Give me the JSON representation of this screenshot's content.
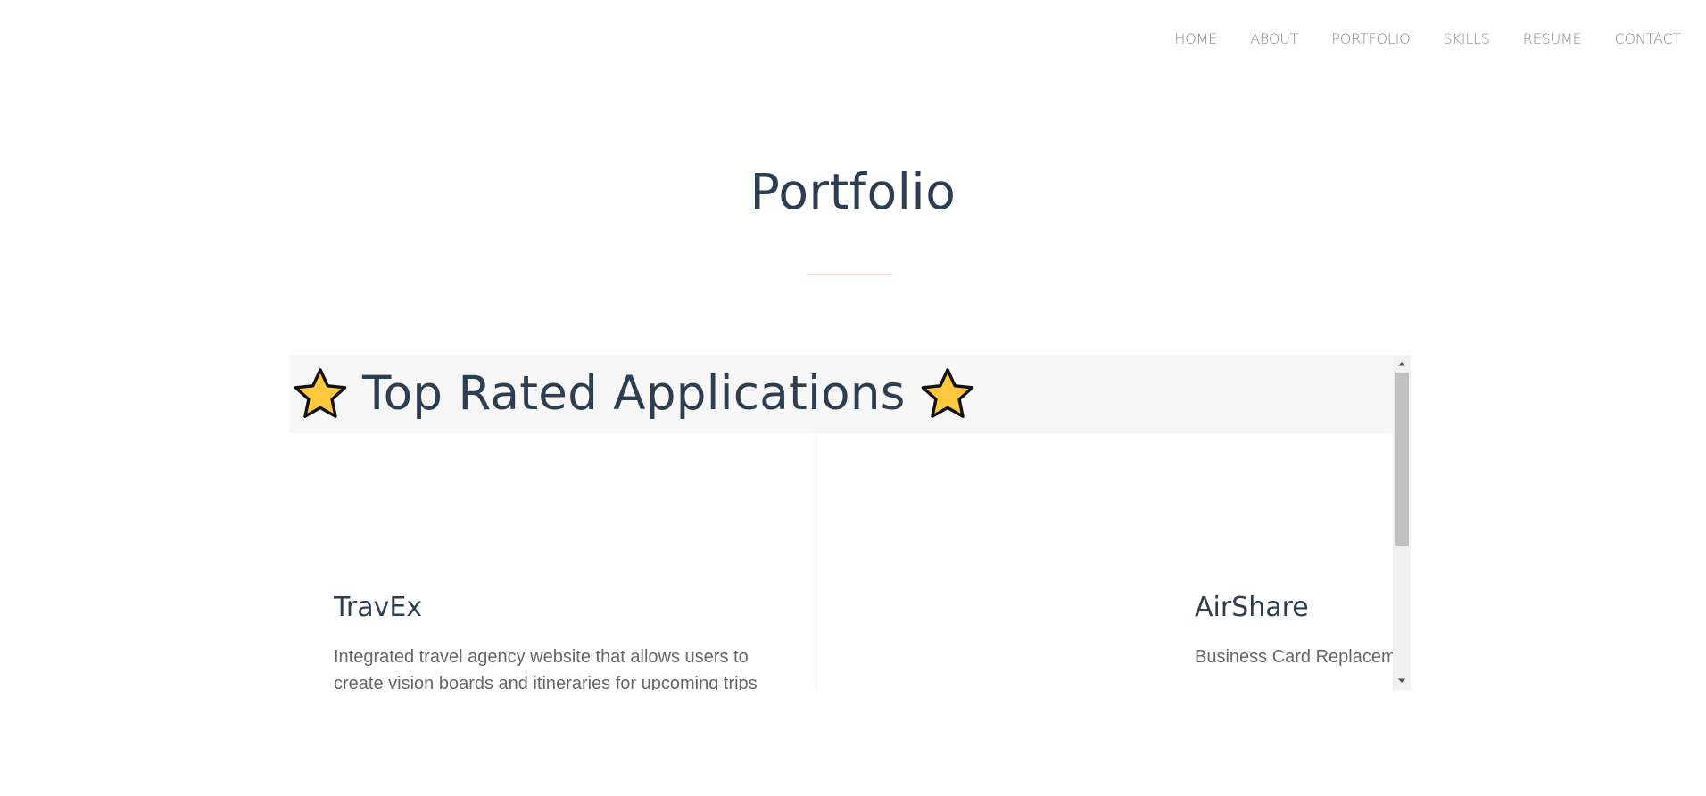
{
  "nav": {
    "items": [
      "HOME",
      "ABOUT",
      "PORTFOLIO",
      "SKILLS",
      "RESUME",
      "CONTACT"
    ]
  },
  "page": {
    "title": "Portfolio"
  },
  "section": {
    "heading": "Top Rated Applications",
    "icon": "star-icon"
  },
  "cards": [
    {
      "name": "TravEx",
      "description": "Integrated travel agency website that allows users to create vision boards and itineraries for upcoming trips"
    },
    {
      "name": "AirShare",
      "description": "Business Card Replacement"
    }
  ],
  "colors": {
    "heading": "#2c3e50",
    "nav_text": "#8a8a8a",
    "divider": "#f6d7cb",
    "star_fill": "#ffc83d",
    "body_text": "#666666"
  }
}
